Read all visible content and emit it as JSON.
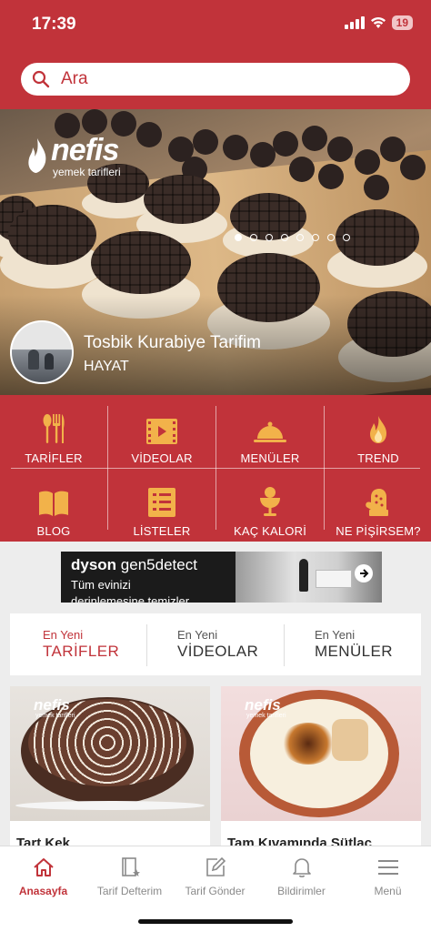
{
  "status_bar": {
    "time": "17:39",
    "battery": "19",
    "icons": [
      "signal-icon",
      "wifi-icon",
      "battery-icon"
    ]
  },
  "search": {
    "placeholder": "Ara",
    "icon": "search-icon"
  },
  "hero": {
    "logo_word": "nefis",
    "logo_sub": "yemek tarifleri",
    "title": "Tosbik Kurabiye Tarifim",
    "author": "HAYAT",
    "slide_count": 8,
    "active_slide": 1
  },
  "categories": [
    {
      "label": "TARİFLER",
      "icon": "utensils-icon"
    },
    {
      "label": "VİDEOLAR",
      "icon": "film-icon"
    },
    {
      "label": "MENÜLER",
      "icon": "cloche-icon"
    },
    {
      "label": "TREND",
      "icon": "flame-icon"
    },
    {
      "label": "BLOG",
      "icon": "book-icon"
    },
    {
      "label": "LİSTELER",
      "icon": "list-icon"
    },
    {
      "label": "KAÇ KALORİ",
      "icon": "ice-cream-icon"
    },
    {
      "label": "NE PİŞİRSEM?",
      "icon": "oven-mitt-icon"
    }
  ],
  "ad": {
    "brand": "dyson",
    "product": "gen5detect",
    "line1": "Tüm evinizi",
    "line2": "derinlemesine temizler"
  },
  "tabs": [
    {
      "top": "En Yeni",
      "label": "TARİFLER",
      "active": true
    },
    {
      "top": "En Yeni",
      "label": "VİDEOLAR",
      "active": false
    },
    {
      "top": "En Yeni",
      "label": "MENÜLER",
      "active": false
    }
  ],
  "cards": [
    {
      "title": "Tart Kek",
      "logo_word": "nefis",
      "logo_sub": "yemek tarifleri"
    },
    {
      "title": "Tam Kıvamında Sütlaç",
      "logo_word": "nefis",
      "logo_sub": "yemek tarifleri"
    }
  ],
  "tabbar": [
    {
      "label": "Anasayfa",
      "icon": "home-icon",
      "active": true
    },
    {
      "label": "Tarif Defterim",
      "icon": "notebook-icon",
      "active": false
    },
    {
      "label": "Tarif Gönder",
      "icon": "send-recipe-icon",
      "active": false
    },
    {
      "label": "Bildirimler",
      "icon": "bell-icon",
      "active": false
    },
    {
      "label": "Menü",
      "icon": "hamburger-icon",
      "active": false
    }
  ],
  "colors": {
    "brand": "#c1333a",
    "inactive": "#8a8a8a",
    "icon_gold": "#f2b24a"
  }
}
